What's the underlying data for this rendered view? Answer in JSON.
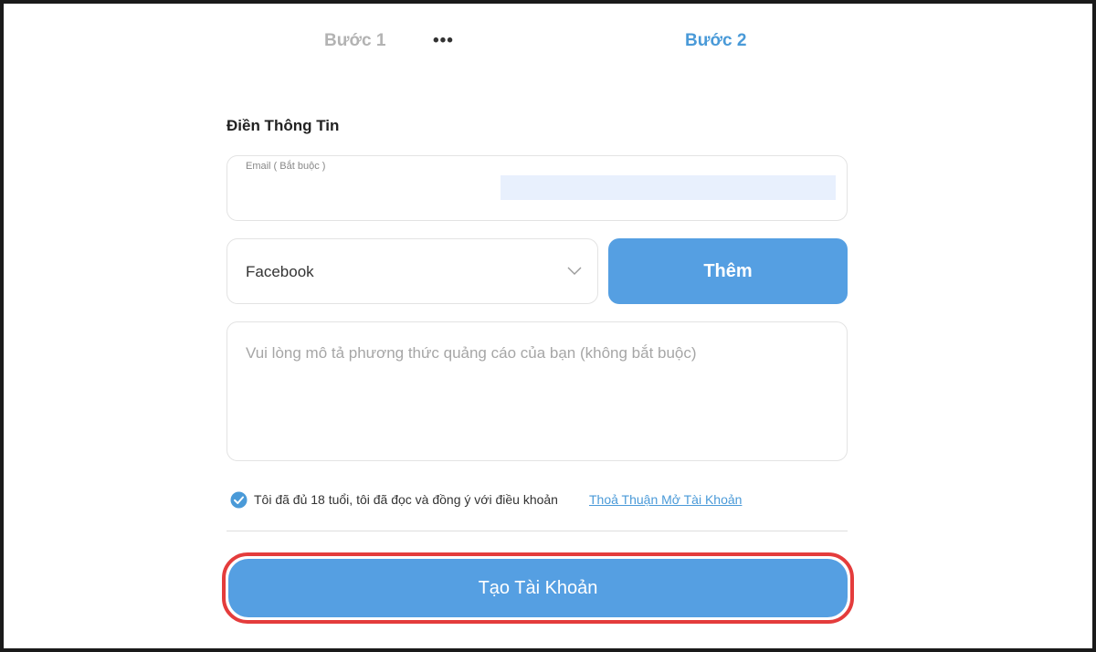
{
  "steps": {
    "step1_label": "Bước 1",
    "separator": "•••",
    "step2_label": "Bước 2"
  },
  "form": {
    "section_title": "Điền Thông Tin",
    "email": {
      "label": "Email ( Bắt buộc )",
      "value": ""
    },
    "platform_select": {
      "selected": "Facebook"
    },
    "add_button_label": "Thêm",
    "description": {
      "placeholder": "Vui lòng mô tả phương thức quảng cáo của bạn (không bắt buộc)"
    },
    "agreement": {
      "checked": true,
      "text": "Tôi đã đủ 18 tuổi, tôi đã đọc và đồng ý với điều khoản",
      "link_text": "Thoả Thuận Mở Tài Khoản"
    },
    "submit_label": "Tạo Tài Khoản"
  },
  "colors": {
    "accent": "#559fe2",
    "link": "#4a9ad8",
    "highlight_outline": "#e43c3c"
  }
}
